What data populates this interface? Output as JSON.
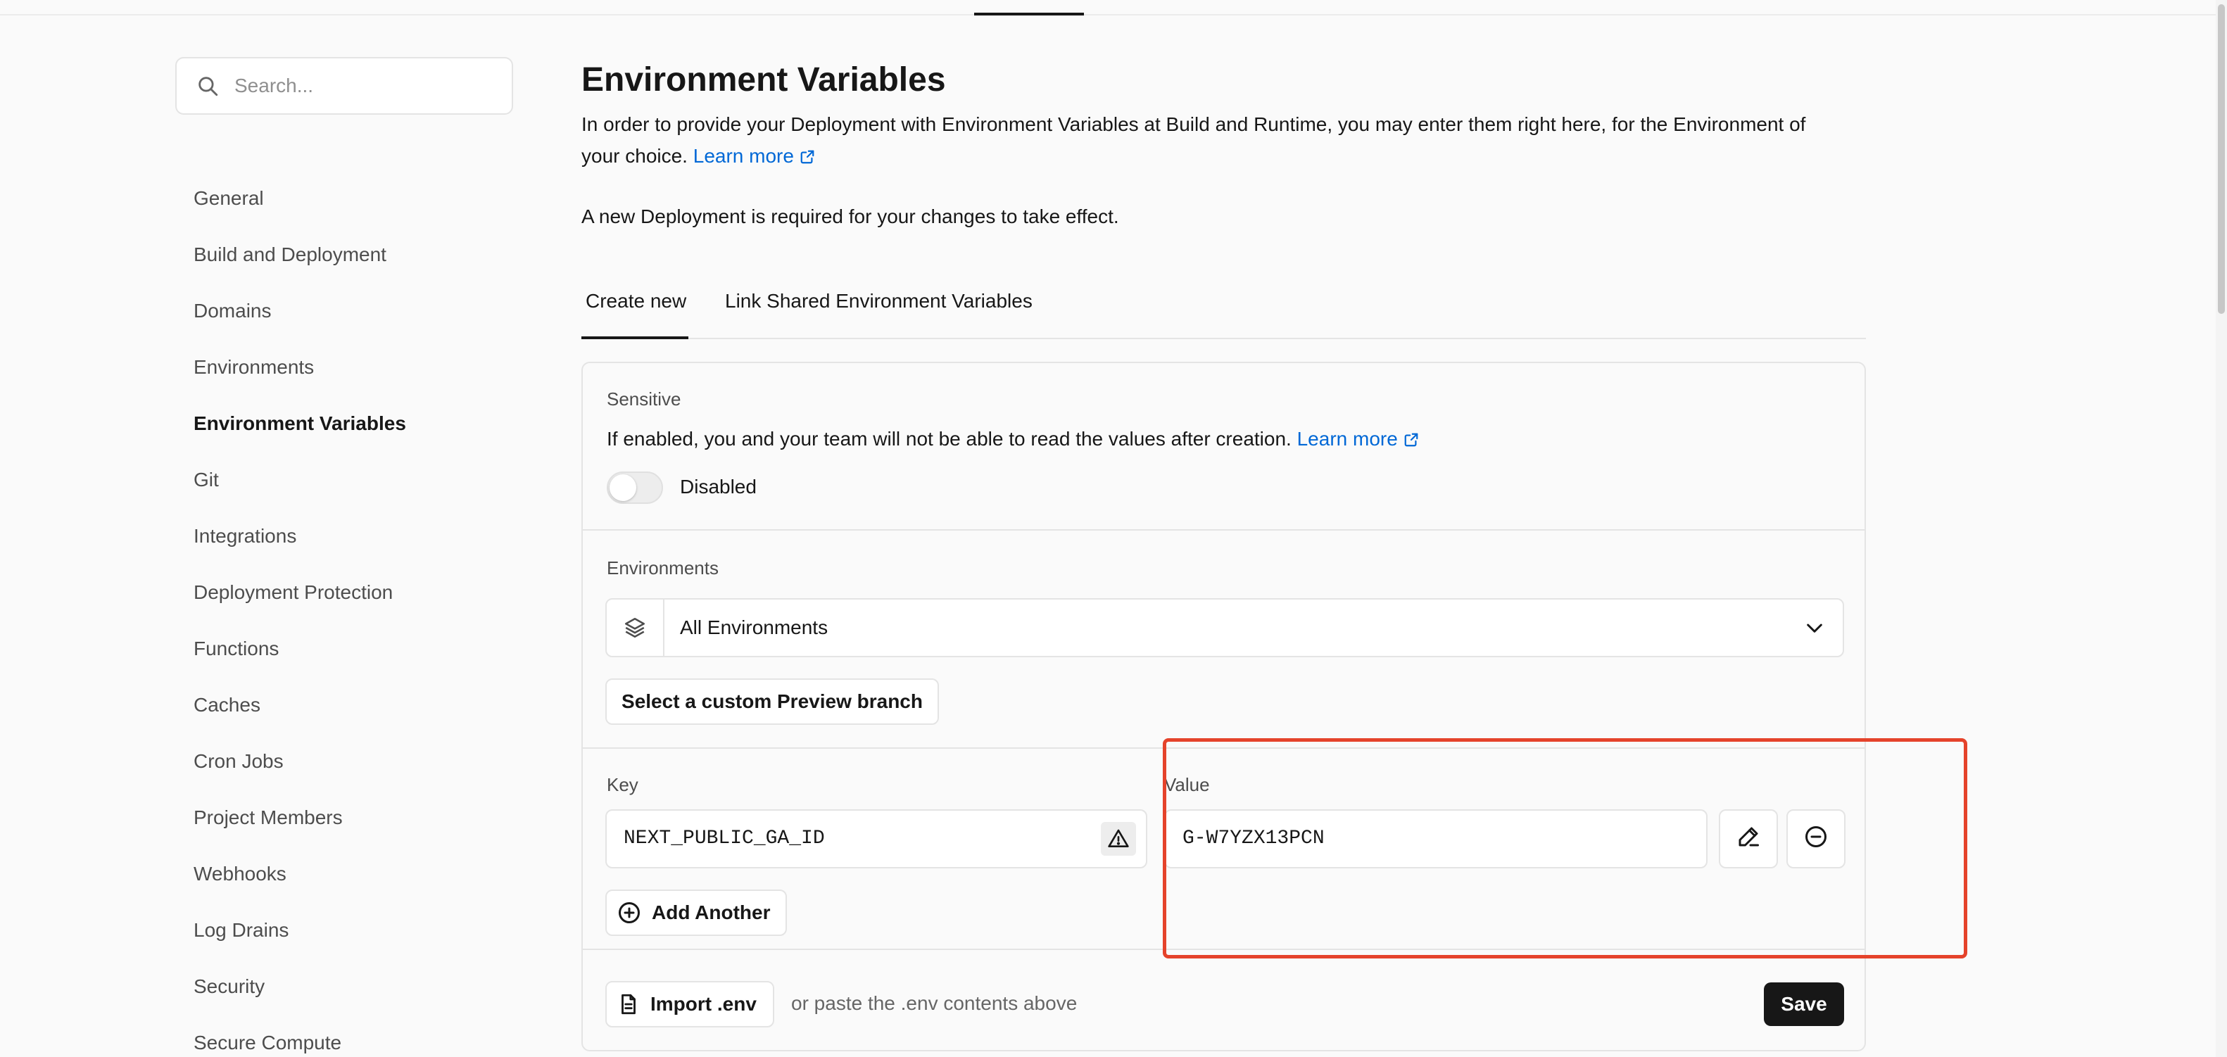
{
  "search": {
    "placeholder": "Search..."
  },
  "sidebar": {
    "items": [
      {
        "label": "General"
      },
      {
        "label": "Build and Deployment"
      },
      {
        "label": "Domains"
      },
      {
        "label": "Environments"
      },
      {
        "label": "Environment Variables"
      },
      {
        "label": "Git"
      },
      {
        "label": "Integrations"
      },
      {
        "label": "Deployment Protection"
      },
      {
        "label": "Functions"
      },
      {
        "label": "Caches"
      },
      {
        "label": "Cron Jobs"
      },
      {
        "label": "Project Members"
      },
      {
        "label": "Webhooks"
      },
      {
        "label": "Log Drains"
      },
      {
        "label": "Security"
      },
      {
        "label": "Secure Compute"
      }
    ],
    "active": "Environment Variables"
  },
  "page": {
    "title": "Environment Variables",
    "description": "In order to provide your Deployment with Environment Variables at Build and Runtime, you may enter them right here, for the Environment of your choice.",
    "learn_more": "Learn more",
    "note": "A new Deployment is required for your changes to take effect."
  },
  "tabs": [
    {
      "label": "Create new"
    },
    {
      "label": "Link Shared Environment Variables"
    }
  ],
  "sensitive": {
    "label": "Sensitive",
    "description": "If enabled, you and your team will not be able to read the values after creation.",
    "learn_more": "Learn more",
    "toggle_state": "Disabled"
  },
  "environments": {
    "label": "Environments",
    "selected": "All Environments",
    "preview_branch_button": "Select a custom Preview branch"
  },
  "variable": {
    "key_label": "Key",
    "value_label": "Value",
    "key": "NEXT_PUBLIC_GA_ID",
    "value": "G-W7YZX13PCN"
  },
  "actions": {
    "add_another": "Add Another",
    "import_env": "Import .env",
    "paste_note": "or paste the .env contents above",
    "save": "Save"
  },
  "colors": {
    "link": "#0068d6",
    "highlight": "#e5432b",
    "save_bg": "#171717"
  }
}
